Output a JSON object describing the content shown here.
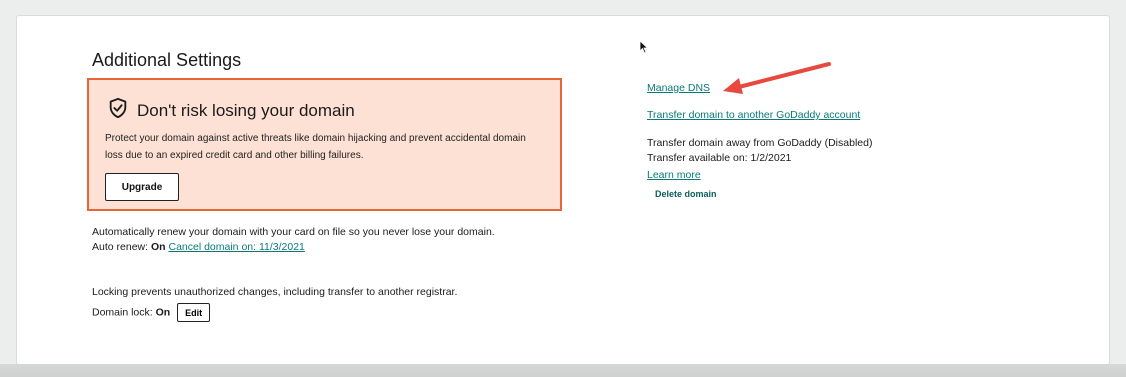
{
  "section": {
    "title": "Additional Settings"
  },
  "promo": {
    "shield_icon": "shield-check-icon",
    "title": "Don't risk losing your domain",
    "description": "Protect your domain against active threats like domain hijacking and prevent accidental domain loss due to an expired credit card and other billing failures.",
    "upgrade_label": "Upgrade",
    "background_color": "#fde1d4",
    "border_color": "#e8653a"
  },
  "auto_renew": {
    "description": "Automatically renew your domain with your card on file so you never lose your domain.",
    "label": "Auto renew:",
    "status": "On",
    "cancel_link": "Cancel domain on: 11/3/2021"
  },
  "domain_lock": {
    "description": "Locking prevents unauthorized changes, including transfer to another registrar.",
    "label": "Domain lock:",
    "status": "On",
    "edit_label": "Edit"
  },
  "actions": {
    "manage_dns": "Manage DNS",
    "transfer_to_account": "Transfer domain to another GoDaddy account",
    "transfer_away": "Transfer domain away from GoDaddy (Disabled)",
    "transfer_available": "Transfer available on: 1/2/2021",
    "learn_more": "Learn more",
    "delete_domain": "Delete domain"
  },
  "colors": {
    "link": "#0a7a78",
    "annotation_arrow": "#e8493f"
  }
}
